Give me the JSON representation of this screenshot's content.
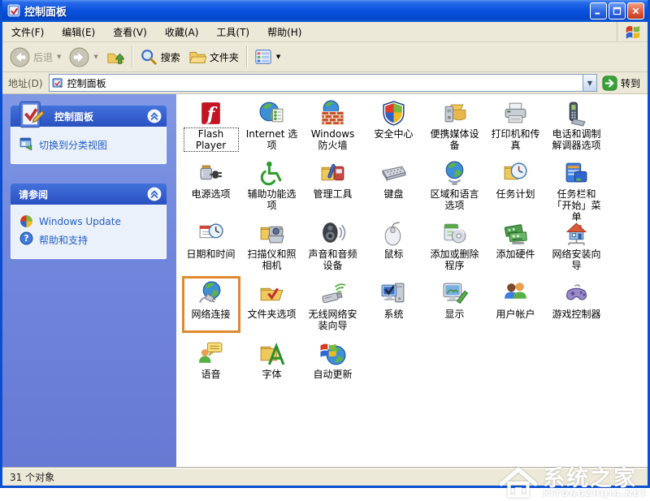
{
  "window": {
    "title": "控制面板"
  },
  "window_controls": {
    "minimize": "minimize",
    "maximize": "maximize",
    "close": "close"
  },
  "menu_bar": {
    "items": [
      "文件(F)",
      "编辑(E)",
      "查看(V)",
      "收藏(A)",
      "工具(T)",
      "帮助(H)"
    ]
  },
  "toolbar": {
    "back_label": "后退",
    "search_label": "搜索",
    "folders_label": "文件夹"
  },
  "address_bar": {
    "label": "地址(D)",
    "value": "控制面板",
    "go_label": "转到"
  },
  "sidebar": {
    "panels": [
      {
        "title": "控制面板",
        "items": [
          {
            "label": "切换到分类视图",
            "icon": "switch-category-view-icon"
          }
        ]
      },
      {
        "title": "请参阅",
        "items": [
          {
            "label": "Windows Update",
            "icon": "windows-update-icon"
          },
          {
            "label": "帮助和支持",
            "icon": "help-support-icon"
          }
        ]
      }
    ]
  },
  "content": {
    "items": [
      {
        "label": "Flash Player",
        "icon": "flash-player-icon",
        "selected": true
      },
      {
        "label": "Internet 选项",
        "icon": "internet-options-icon"
      },
      {
        "label": "Windows 防火墙",
        "icon": "windows-firewall-icon"
      },
      {
        "label": "安全中心",
        "icon": "security-center-icon"
      },
      {
        "label": "便携媒体设备",
        "icon": "portable-media-devices-icon"
      },
      {
        "label": "打印机和传真",
        "icon": "printers-faxes-icon"
      },
      {
        "label": "电话和调制解调器选项",
        "icon": "phone-modem-icon"
      },
      {
        "label": "电源选项",
        "icon": "power-options-icon"
      },
      {
        "label": "辅助功能选项",
        "icon": "accessibility-options-icon"
      },
      {
        "label": "管理工具",
        "icon": "administrative-tools-icon"
      },
      {
        "label": "键盘",
        "icon": "keyboard-icon"
      },
      {
        "label": "区域和语言选项",
        "icon": "regional-language-icon"
      },
      {
        "label": "任务计划",
        "icon": "scheduled-tasks-icon"
      },
      {
        "label": "任务栏和「开始」菜单",
        "icon": "taskbar-startmenu-icon"
      },
      {
        "label": "日期和时间",
        "icon": "date-time-icon"
      },
      {
        "label": "扫描仪和照相机",
        "icon": "scanners-cameras-icon"
      },
      {
        "label": "声音和音频设备",
        "icon": "sounds-audio-icon"
      },
      {
        "label": "鼠标",
        "icon": "mouse-icon"
      },
      {
        "label": "添加或删除程序",
        "icon": "add-remove-programs-icon"
      },
      {
        "label": "添加硬件",
        "icon": "add-hardware-icon"
      },
      {
        "label": "网络安装向导",
        "icon": "network-setup-wizard-icon"
      },
      {
        "label": "网络连接",
        "icon": "network-connections-icon",
        "highlighted": true
      },
      {
        "label": "文件夹选项",
        "icon": "folder-options-icon"
      },
      {
        "label": "无线网络安装向导",
        "icon": "wireless-network-wizard-icon"
      },
      {
        "label": "系统",
        "icon": "system-icon"
      },
      {
        "label": "显示",
        "icon": "display-icon"
      },
      {
        "label": "用户帐户",
        "icon": "user-accounts-icon"
      },
      {
        "label": "游戏控制器",
        "icon": "game-controllers-icon"
      },
      {
        "label": "语音",
        "icon": "speech-icon"
      },
      {
        "label": "字体",
        "icon": "fonts-icon"
      },
      {
        "label": "自动更新",
        "icon": "automatic-updates-icon"
      }
    ]
  },
  "status_bar": {
    "text": "31 个对象"
  },
  "watermark": {
    "title": "系统之家",
    "subtitle": "XITONGZHIJIA.NET"
  },
  "colors": {
    "highlight_orange": "#E0882E",
    "titlebar_blue": "#0A53E0",
    "sidebar_blue": "#7187DC",
    "link_blue": "#215DC6"
  }
}
